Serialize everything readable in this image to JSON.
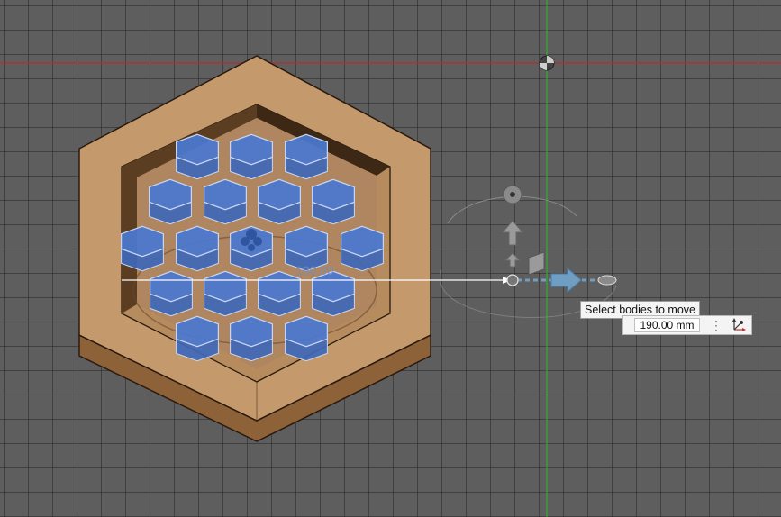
{
  "viewport": {
    "dimension_value": "190.00",
    "tooltip": "Select bodies to move",
    "distance_field": {
      "value": "190.00 mm"
    },
    "icons": [
      "origin-marker-icon",
      "rotate-handle-icon",
      "arrow-up-icon",
      "plane-handle-icon",
      "arrow-right-icon",
      "more-options-icon",
      "triad-icon"
    ]
  },
  "colors": {
    "grid_background": "#5e5e5e",
    "wood": "#c49a6c",
    "selected_body": "#4a78d0",
    "x_axis": "#b03030",
    "y_axis": "#2fae2f",
    "manipulator_arrow": "#6f9ec2"
  }
}
